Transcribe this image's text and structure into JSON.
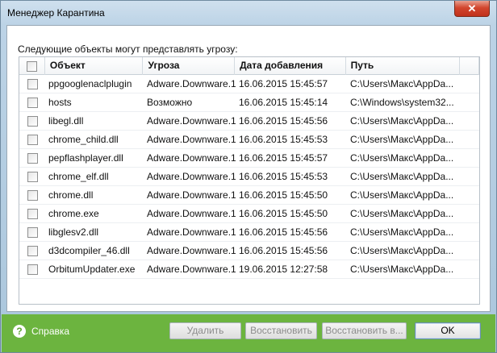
{
  "window": {
    "title": "Менеджер Карантина"
  },
  "content": {
    "subtitle": "Следующие объекты могут представлять угрозу:"
  },
  "table": {
    "columns": [
      "Объект",
      "Угроза",
      "Дата добавления",
      "Путь"
    ],
    "rows": [
      {
        "object": "ppgooglenaclplugin",
        "threat": "Adware.Downware.1",
        "date": "16.06.2015 15:45:57",
        "path": "C:\\Users\\Макс\\AppDa..."
      },
      {
        "object": "hosts",
        "threat": "Возможно",
        "date": "16.06.2015 15:45:14",
        "path": "C:\\Windows\\system32..."
      },
      {
        "object": "libegl.dll",
        "threat": "Adware.Downware.1",
        "date": "16.06.2015 15:45:56",
        "path": "C:\\Users\\Макс\\AppDa..."
      },
      {
        "object": "chrome_child.dll",
        "threat": "Adware.Downware.1",
        "date": "16.06.2015 15:45:53",
        "path": "C:\\Users\\Макс\\AppDa..."
      },
      {
        "object": "pepflashplayer.dll",
        "threat": "Adware.Downware.1",
        "date": "16.06.2015 15:45:57",
        "path": "C:\\Users\\Макс\\AppDa..."
      },
      {
        "object": "chrome_elf.dll",
        "threat": "Adware.Downware.1",
        "date": "16.06.2015 15:45:53",
        "path": "C:\\Users\\Макс\\AppDa..."
      },
      {
        "object": "chrome.dll",
        "threat": "Adware.Downware.1",
        "date": "16.06.2015 15:45:50",
        "path": "C:\\Users\\Макс\\AppDa..."
      },
      {
        "object": "chrome.exe",
        "threat": "Adware.Downware.1",
        "date": "16.06.2015 15:45:50",
        "path": "C:\\Users\\Макс\\AppDa..."
      },
      {
        "object": "libglesv2.dll",
        "threat": "Adware.Downware.1",
        "date": "16.06.2015 15:45:56",
        "path": "C:\\Users\\Макс\\AppDa..."
      },
      {
        "object": "d3dcompiler_46.dll",
        "threat": "Adware.Downware.1",
        "date": "16.06.2015 15:45:56",
        "path": "C:\\Users\\Макс\\AppDa..."
      },
      {
        "object": "OrbitumUpdater.exe",
        "threat": "Adware.Downware.1",
        "date": "19.06.2015 12:27:58",
        "path": "C:\\Users\\Макс\\AppDa..."
      }
    ]
  },
  "footer": {
    "help_label": "Справка",
    "delete_label": "Удалить",
    "restore_label": "Восстановить",
    "restore_to_label": "Восстановить в...",
    "ok_label": "OK"
  },
  "colors": {
    "footer": "#6cb43f",
    "close": "#c0311b"
  }
}
